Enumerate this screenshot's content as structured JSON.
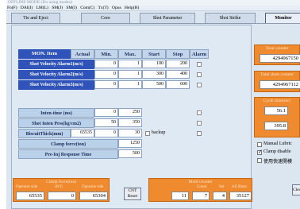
{
  "title": "OFFLINE MODE (Do using modes)",
  "menu": [
    "Fn(F)",
    "DAI(I)",
    "LM(L)",
    "SM(J)",
    "SM(I)",
    "Com(C)",
    "Tx(T)",
    "Opus",
    "Help(H)"
  ],
  "tabs": [
    "Tie and Eject",
    "Core",
    "Shot Parameter",
    "Shot Strike",
    "Monitor"
  ],
  "table": {
    "headers": [
      "MON. Item",
      "Actual",
      "Min.",
      "Max.",
      "Start",
      "Stop",
      "Alarm"
    ],
    "rows": [
      {
        "label": "Shot Velocity Alarm1(m/s)",
        "actual": "",
        "min": "0",
        "max": "1",
        "start": "100",
        "stop": "200"
      },
      {
        "label": "Shot Velocity Alarm2(m/s)",
        "actual": "",
        "min": "0",
        "max": "1",
        "start": "300",
        "stop": "400"
      },
      {
        "label": "Shot Velocity Alarm3(m/s)",
        "actual": "",
        "min": "0",
        "max": "1",
        "start": "500",
        "stop": "600"
      }
    ]
  },
  "params": {
    "intens_label": "Inten-time (ms)",
    "intens_min": "0",
    "intens_max": "250",
    "press_label": "Shot Inten Prss(kg/cm2)",
    "press_min": "50",
    "press_max": "350",
    "biscuit_label": "BiscuitThick(mm)",
    "biscuit_actual": "65535",
    "biscuit_min": "0",
    "biscuit_max": "30",
    "backup_label": "backup",
    "clamp_label": "Clamp force(ton)",
    "clamp_val": "1250",
    "pre_label": "Pre-Inj Response Time",
    "pre_val": "500"
  },
  "clamp_panel": {
    "title": "Clamp force(ton)",
    "labels": [
      "Operator side",
      "AVG",
      "Opposite side"
    ],
    "values": [
      "65535",
      "0",
      "65304"
    ]
  },
  "cnt_button": {
    "line1": "CNT",
    "line2": "Reset"
  },
  "mold_panel": {
    "title": "Mold counter",
    "labels": [
      "",
      "Count",
      "Set",
      "All Shots"
    ],
    "values": [
      "11",
      "7",
      "4",
      "35127"
    ]
  },
  "right": {
    "box1_title": "Total counter",
    "box1_value": "4294967150",
    "box2_title": "Total shots counter",
    "box2_value": "4294967112",
    "box3_title": "Cycle time(sec)",
    "box3_value1": "56.1",
    "box3_value2": "395.8",
    "check1": "Manual Lubric",
    "check2": "Clamp disable",
    "check3": "使用快速開模",
    "button": "Clear"
  },
  "colors": {
    "accent": "#2f53b8",
    "orange": "#f08a2e",
    "panel": "#dfe9f3"
  }
}
